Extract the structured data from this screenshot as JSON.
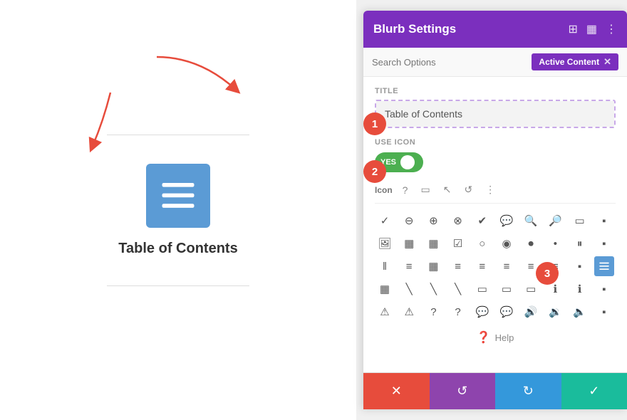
{
  "canvas": {
    "title": "Table of Contents"
  },
  "panel": {
    "title": "Blurb Settings",
    "search_placeholder": "Search Options",
    "active_content_label": "Active Content",
    "fields": {
      "title_label": "Title",
      "title_value": "Table of Contents",
      "use_icon_label": "Use Icon",
      "toggle_yes": "YES",
      "icon_label": "Icon"
    },
    "help_label": "Help",
    "header_icons": [
      "resize-icon",
      "columns-icon",
      "more-icon"
    ],
    "toolbar_icons": [
      "question-icon",
      "mobile-icon",
      "cursor-icon",
      "undo-icon",
      "more-vert-icon"
    ],
    "icons": [
      "✓",
      "⊖",
      "⊕",
      "⊗",
      "✓",
      "◯",
      "◯",
      "◯",
      "▭",
      "▪",
      "▪",
      "▪",
      "▪",
      "✓",
      "◯",
      "◯",
      "▪",
      "▪",
      "⏸",
      "▪",
      "‖",
      "≡",
      "▦",
      "≡",
      "≡",
      "≡",
      "≡",
      "≡",
      "▪",
      "▦",
      "▦",
      "╲",
      "╲",
      "╲",
      "▭",
      "▭",
      "▭",
      "ℹ",
      "ℹ",
      "▪",
      "⚠",
      "⚠",
      "?",
      "?",
      "◯",
      "◯",
      "🔊",
      "🔊",
      "🔊",
      "▪"
    ],
    "active_icon_index": 29,
    "buttons": {
      "cancel": "✕",
      "reset": "↺",
      "redo": "↻",
      "save": "✓"
    },
    "step_badges": [
      {
        "id": 1,
        "label": "1"
      },
      {
        "id": 2,
        "label": "2"
      },
      {
        "id": 3,
        "label": "3"
      }
    ]
  }
}
